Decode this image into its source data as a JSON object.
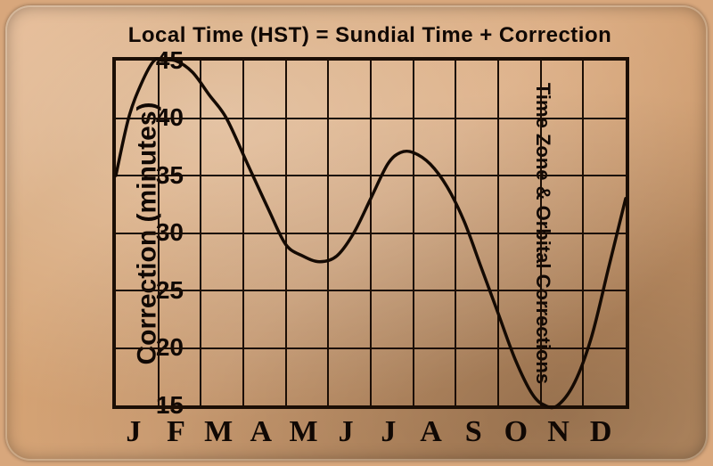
{
  "title": "Local Time (HST)  =  Sundial Time  +  Correction",
  "ylabel": "Correction (minutes)",
  "rlabel": "Time Zone & Orbital Corrections",
  "chart_data": {
    "type": "line",
    "title": "Local Time (HST) = Sundial Time + Correction",
    "xlabel": "",
    "ylabel": "Correction (minutes)",
    "categories": [
      "J",
      "F",
      "M",
      "A",
      "M",
      "J",
      "J",
      "A",
      "S",
      "O",
      "N",
      "D"
    ],
    "x": [
      1,
      2,
      3,
      4,
      5,
      6,
      7,
      8,
      9,
      10,
      11,
      12
    ],
    "values": [
      35,
      45,
      44,
      35,
      28,
      28,
      34,
      37,
      31,
      21,
      15,
      20
    ],
    "ylim": [
      15,
      45
    ],
    "xlim": [
      1,
      13
    ],
    "y_ticks": [
      15,
      20,
      25,
      30,
      35,
      40,
      45
    ],
    "x_tick_labels": [
      "J",
      "F",
      "M",
      "A",
      "M",
      "J",
      "J",
      "A",
      "S",
      "O",
      "N",
      "D"
    ],
    "grid": true,
    "legend": false,
    "note": "Right label: Time Zone & Orbital Corrections. Curve extends to month 13 at ~33."
  }
}
